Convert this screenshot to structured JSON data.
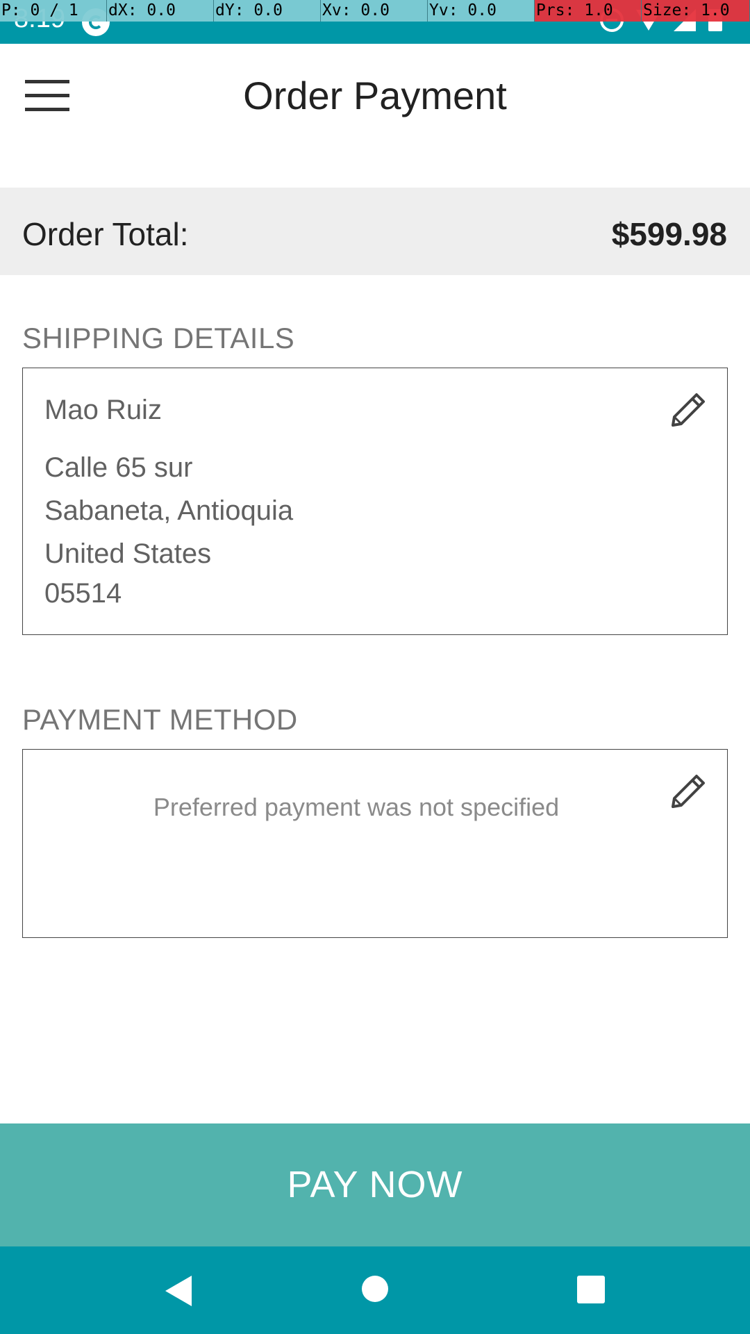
{
  "status_bar": {
    "time": "8:19",
    "icons": [
      "sync-icon",
      "do-not-disturb-icon",
      "wifi-icon",
      "signal-icon",
      "battery-icon"
    ]
  },
  "debug_overlay": {
    "pointer": "P: 0 / 1",
    "dx": "dX: 0.0",
    "dy": "dY: 0.0",
    "xv": "Xv: 0.0",
    "yv": "Yv: 0.0",
    "prs": "Prs: 1.0",
    "size": "Size: 1.0"
  },
  "app_bar": {
    "title": "Order Payment",
    "menu_icon": "hamburger-menu-icon"
  },
  "order_total": {
    "label": "Order Total:",
    "value": "$599.98"
  },
  "shipping": {
    "heading": "SHIPPING DETAILS",
    "name": "Mao Ruiz",
    "street": "Calle 65 sur",
    "city_region": "Sabaneta, Antioquia",
    "country": "United States",
    "postal_code": "05514",
    "edit_icon": "pencil-icon"
  },
  "payment": {
    "heading": "PAYMENT METHOD",
    "empty_text": "Preferred payment was not specified",
    "edit_icon": "pencil-icon"
  },
  "pay_button": {
    "label": "PAY NOW"
  },
  "nav_bar": {
    "icons": [
      "back-icon",
      "home-icon",
      "recents-icon"
    ]
  },
  "colors": {
    "status_bar": "#0097a7",
    "pay_button": "#52b3ad",
    "order_total_bg": "#eeeeee"
  }
}
